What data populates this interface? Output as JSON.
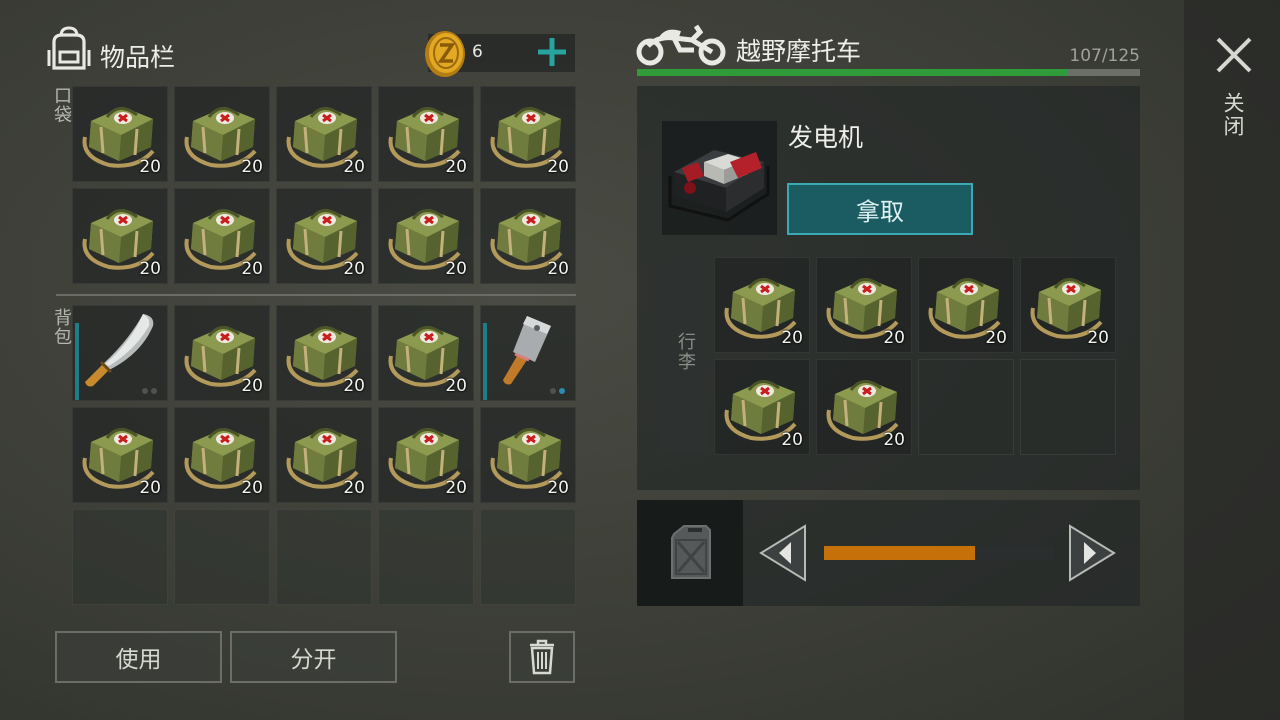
{
  "inventory": {
    "title": "物品栏",
    "coins": "6",
    "pocket_label": "口袋",
    "backpack_label": "背包",
    "pocket_slots": [
      {
        "icon": "medkit-bag-icon",
        "qty": "20"
      },
      {
        "icon": "medkit-bag-icon",
        "qty": "20"
      },
      {
        "icon": "medkit-bag-icon",
        "qty": "20"
      },
      {
        "icon": "medkit-bag-icon",
        "qty": "20"
      },
      {
        "icon": "medkit-bag-icon",
        "qty": "20"
      },
      {
        "icon": "medkit-bag-icon",
        "qty": "20"
      },
      {
        "icon": "medkit-bag-icon",
        "qty": "20"
      },
      {
        "icon": "medkit-bag-icon",
        "qty": "20"
      },
      {
        "icon": "medkit-bag-icon",
        "qty": "20"
      },
      {
        "icon": "medkit-bag-icon",
        "qty": "20"
      }
    ],
    "backpack_slots": [
      {
        "icon": "machete-icon",
        "qty": "",
        "durability": 0.82,
        "dots_active": 0
      },
      {
        "icon": "medkit-bag-icon",
        "qty": "20"
      },
      {
        "icon": "medkit-bag-icon",
        "qty": "20"
      },
      {
        "icon": "medkit-bag-icon",
        "qty": "20"
      },
      {
        "icon": "cleaver-icon",
        "qty": "",
        "durability": 0.82,
        "dots_active": 1
      },
      {
        "icon": "medkit-bag-icon",
        "qty": "20"
      },
      {
        "icon": "medkit-bag-icon",
        "qty": "20"
      },
      {
        "icon": "medkit-bag-icon",
        "qty": "20"
      },
      {
        "icon": "medkit-bag-icon",
        "qty": "20"
      },
      {
        "icon": "medkit-bag-icon",
        "qty": "20"
      },
      {
        "icon": "",
        "qty": ""
      },
      {
        "icon": "",
        "qty": ""
      },
      {
        "icon": "",
        "qty": ""
      },
      {
        "icon": "",
        "qty": ""
      },
      {
        "icon": "",
        "qty": ""
      }
    ],
    "use_label": "使用",
    "split_label": "分开"
  },
  "vehicle": {
    "title": "越野摩托车",
    "capacity_text": "107/125",
    "capacity_fraction": 0.856,
    "slot_item": {
      "name": "发电机",
      "icon": "generator-icon"
    },
    "take_label": "拿取",
    "luggage_label": "行李",
    "luggage_slots": [
      {
        "icon": "medkit-bag-icon",
        "qty": "20"
      },
      {
        "icon": "medkit-bag-icon",
        "qty": "20"
      },
      {
        "icon": "medkit-bag-icon",
        "qty": "20"
      },
      {
        "icon": "medkit-bag-icon",
        "qty": "20"
      },
      {
        "icon": "medkit-bag-icon",
        "qty": "20"
      },
      {
        "icon": "medkit-bag-icon",
        "qty": "20"
      },
      {
        "icon": "",
        "qty": ""
      },
      {
        "icon": "",
        "qty": ""
      }
    ],
    "fuel_fraction": 0.66
  },
  "sidebar": {
    "close_label": "关闭"
  },
  "colors": {
    "accent_teal": "#3aaab4",
    "capacity_green": "#2f9c39",
    "fuel_orange": "#c57009",
    "plus_teal": "#27a3a0"
  }
}
